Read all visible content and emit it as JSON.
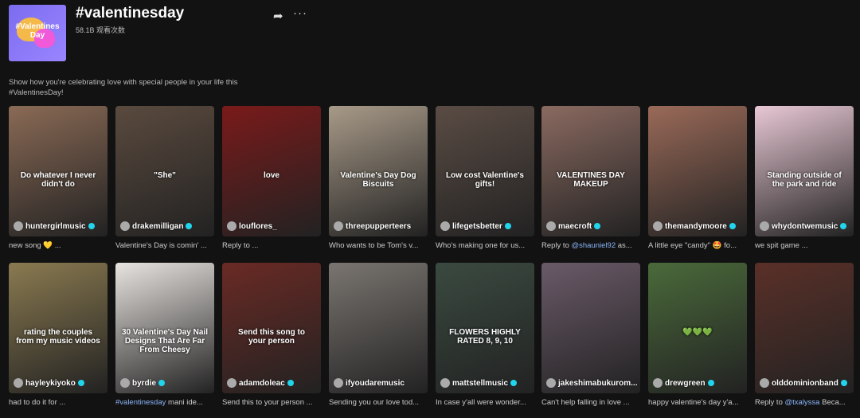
{
  "header": {
    "cover_text": "#Valentines Day",
    "title": "#valentinesday",
    "views": "58.1B 观看次数",
    "description": "Show how you're celebrating love with special people in your life this #ValentinesDay!"
  },
  "videos": [
    {
      "user": "huntergirlmusic",
      "verified": true,
      "caption": "new song 💛 ...",
      "overlay": "Do whatever I never didn't do",
      "bg": "#8a6a55"
    },
    {
      "user": "drakemilligan",
      "verified": true,
      "caption": "Valentine's Day is comin' ...",
      "overlay": "\"She\"",
      "bg": "#5a4a3e"
    },
    {
      "user": "louflores_",
      "verified": false,
      "caption": "Reply to ...",
      "overlay": "love",
      "bg": "#7a1a1a"
    },
    {
      "user": "threepupperteers",
      "verified": false,
      "caption": "Who wants to be Tom's v...",
      "overlay": "Valentine's Day Dog Biscuits",
      "bg": "#a89a88"
    },
    {
      "user": "lifegetsbetter",
      "verified": true,
      "caption": "Who's making one for us...",
      "overlay": "Low cost Valentine's gifts!",
      "bg": "#5a4c44"
    },
    {
      "user": "maecroft",
      "verified": true,
      "caption_prefix": "Reply to ",
      "mention": "@shauniel92",
      "caption_suffix": " as...",
      "overlay": "VALENTINES DAY MAKEUP",
      "bg": "#8a6a60"
    },
    {
      "user": "themandymoore",
      "verified": true,
      "caption": "A little eye \"candy\" 🤩 fo...",
      "overlay": "",
      "bg": "#9a6a58"
    },
    {
      "user": "whydontwemusic",
      "verified": true,
      "caption": "we spit game ...",
      "overlay": "Standing outside of the park and ride",
      "bg": "#e8c8d4"
    },
    {
      "user": "hayleykiyoko",
      "verified": true,
      "caption": "had to do it for ...",
      "overlay": "rating the couples from my music videos",
      "bg": "#8a7a50"
    },
    {
      "user": "byrdie",
      "verified": true,
      "caption_tag": "#valentinesday",
      "caption_suffix": " mani ide...",
      "overlay": "30 Valentine's Day Nail Designs That Are Far From Cheesy",
      "bg": "#e8e4e0"
    },
    {
      "user": "adamdoleac",
      "verified": true,
      "caption": "Send this to your person ...",
      "overlay": "Send this song to your person",
      "bg": "#6a2a24"
    },
    {
      "user": "ifyoudaremusic",
      "verified": false,
      "caption": "Sending you our love tod...",
      "overlay": "",
      "bg": "#7a7570"
    },
    {
      "user": "mattstellmusic",
      "verified": true,
      "caption": "In case y'all were wonder...",
      "overlay": "FLOWERS HIGHLY RATED 8, 9, 10",
      "bg": "#3a4a40"
    },
    {
      "user": "jakeshimabukurom...",
      "verified": false,
      "caption": "Can't help falling in love ...",
      "overlay": "",
      "bg": "#6a5a68"
    },
    {
      "user": "drewgreen",
      "verified": true,
      "caption": "happy valentine's day y'a...",
      "overlay": "💚💚💚",
      "bg": "#4a6a3a"
    },
    {
      "user": "olddominionband",
      "verified": true,
      "caption_prefix": "Reply to ",
      "mention": "@txalyssa",
      "caption_suffix": " Beca...",
      "overlay": "",
      "bg": "#5a3028"
    }
  ]
}
